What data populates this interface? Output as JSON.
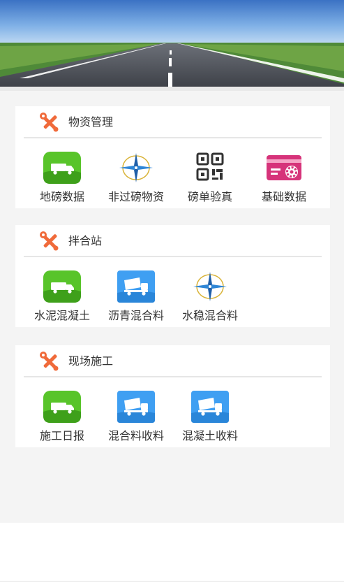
{
  "sections": [
    {
      "title": "物资管理",
      "items": [
        {
          "label": "地磅数据",
          "icon": "truck-scale-icon"
        },
        {
          "label": "非过磅物资",
          "icon": "compass-star-icon"
        },
        {
          "label": "磅单验真",
          "icon": "qr-code-icon"
        },
        {
          "label": "基础数据",
          "icon": "settings-card-icon"
        }
      ]
    },
    {
      "title": "拌合站",
      "items": [
        {
          "label": "水泥混凝土",
          "icon": "truck-scale-icon"
        },
        {
          "label": "沥青混合料",
          "icon": "dump-truck-icon"
        },
        {
          "label": "水稳混合料",
          "icon": "compass-star-icon"
        }
      ]
    },
    {
      "title": "现场施工",
      "items": [
        {
          "label": "施工日报",
          "icon": "truck-scale-icon"
        },
        {
          "label": "混合料收料",
          "icon": "dump-truck-icon"
        },
        {
          "label": "混凝土收料",
          "icon": "dump-truck-icon"
        }
      ]
    }
  ],
  "colors": {
    "section_icon": "#f06a3a",
    "green_tile": "#58c42a",
    "blue_tile": "#3f9ff2",
    "qr": "#333333",
    "pink_card": "#d6337a",
    "compass_blue": "#1f5fa8",
    "compass_gold": "#d9b43a"
  }
}
